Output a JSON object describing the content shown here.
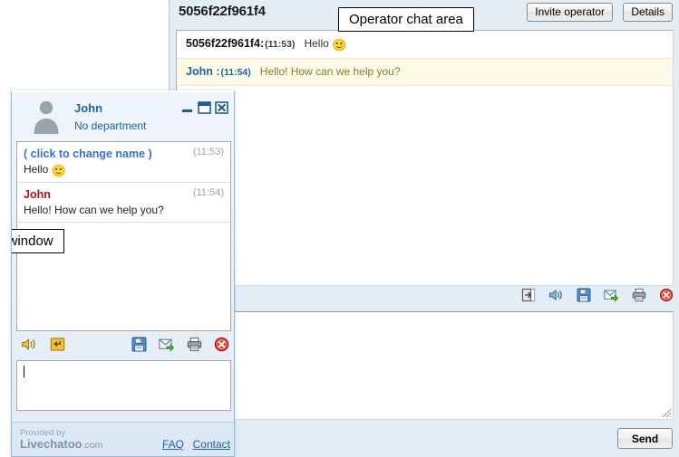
{
  "operator": {
    "title": "5056f22f961f4",
    "buttons": {
      "invite_operator": "Invite operator",
      "details": "Details"
    },
    "messages": [
      {
        "nick": "5056f22f961f4:",
        "time": "(11:53)",
        "text": "Hello",
        "emoji": "🙂",
        "role": "visitor"
      },
      {
        "nick": "John :",
        "time": "(11:54)",
        "text": "Hello! How can we help you?",
        "emoji": "",
        "role": "operator"
      }
    ],
    "toolbar_icons": [
      "transfer-chat-icon",
      "sound-icon",
      "save-chat-icon",
      "email-chat-icon",
      "print-chat-icon",
      "close-chat-icon"
    ],
    "input_value": "",
    "send_label": "Send"
  },
  "annotations": {
    "operator_area": "Operator chat area",
    "website_window": "Website chat window"
  },
  "chat_widget": {
    "nick": "John",
    "department": "No department",
    "window_controls": [
      "minimize-icon",
      "maximize-icon",
      "close-icon"
    ],
    "messages": [
      {
        "nick": "( click to change name )",
        "time": "(11:53)",
        "text": "Hello",
        "emoji": "🙂",
        "role": "visitor"
      },
      {
        "nick": "John",
        "time": "(11:54)",
        "text": "Hello! How can we help you?",
        "emoji": "",
        "role": "operator"
      }
    ],
    "toolbar_left_icons": [
      "sound-icon",
      "transfer-chat-icon"
    ],
    "toolbar_right_icons": [
      "save-chat-icon",
      "email-chat-icon",
      "print-chat-icon",
      "close-chat-icon"
    ],
    "input_value": "",
    "footer": {
      "provided_by": "Provided by",
      "brand": "Livechatoo",
      "brand_tld": ".com",
      "faq": "FAQ",
      "contact": "Contact"
    }
  },
  "colors": {
    "panel_bg": "#e3edf5",
    "operator_msg_bg": "#fdfbe8",
    "link": "#1d63a8",
    "operator_nick": "#b01515",
    "visitor_nick": "#3b6fd0"
  }
}
